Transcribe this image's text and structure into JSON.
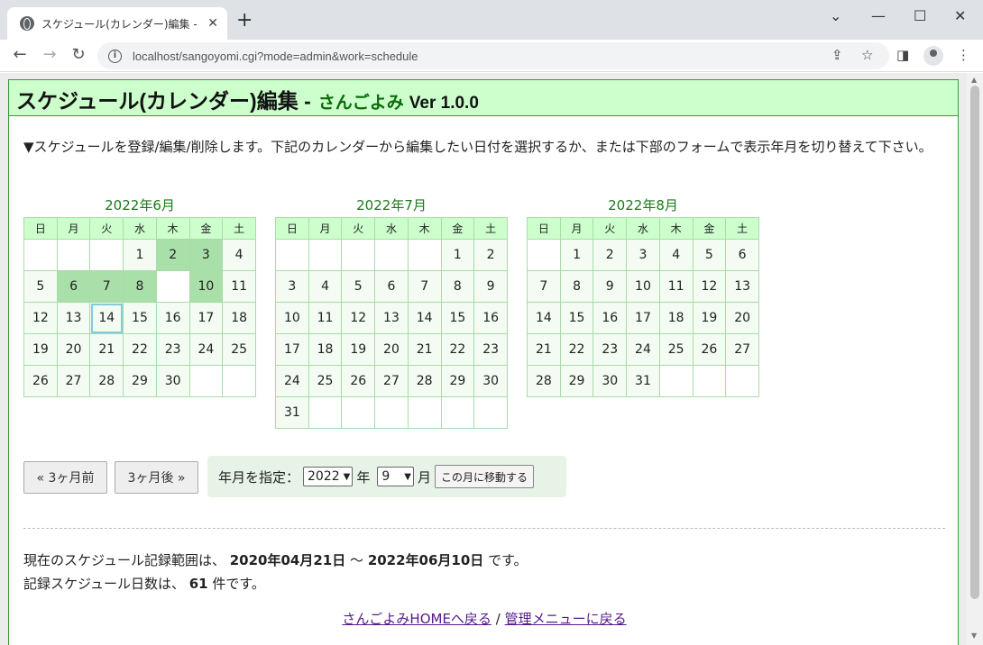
{
  "browser": {
    "tab_title": "スケジュール(カレンダー)編集 - さんごよみ",
    "url": "localhost/sangoyomi.cgi?mode=admin&work=schedule"
  },
  "header": {
    "title": "スケジュール(カレンダー)編集 -",
    "app_name": "さんごよみ",
    "version": "Ver 1.0.0"
  },
  "intro": "▼スケジュールを登録/編集/削除します。下記のカレンダーから編集したい日付を選択するか、または下部のフォームで表示年月を切り替えて下さい。",
  "weekdays": [
    "日",
    "月",
    "火",
    "水",
    "木",
    "金",
    "土"
  ],
  "calendars": [
    {
      "caption": "2022年6月",
      "weeks": [
        [
          "",
          "",
          "",
          "1",
          "2",
          "3",
          "4"
        ],
        [
          "5",
          "6",
          "7",
          "8",
          "",
          "10",
          "11"
        ],
        [
          "12",
          "13",
          "14",
          "15",
          "16",
          "17",
          "18"
        ],
        [
          "19",
          "20",
          "21",
          "22",
          "23",
          "24",
          "25"
        ],
        [
          "26",
          "27",
          "28",
          "29",
          "30",
          "",
          ""
        ]
      ],
      "scheduled": [
        "2",
        "3",
        "6",
        "7",
        "8",
        "10"
      ],
      "today": "14"
    },
    {
      "caption": "2022年7月",
      "weeks": [
        [
          "",
          "",
          "",
          "",
          "",
          "1",
          "2"
        ],
        [
          "3",
          "4",
          "5",
          "6",
          "7",
          "8",
          "9"
        ],
        [
          "10",
          "11",
          "12",
          "13",
          "14",
          "15",
          "16"
        ],
        [
          "17",
          "18",
          "19",
          "20",
          "21",
          "22",
          "23"
        ],
        [
          "24",
          "25",
          "26",
          "27",
          "28",
          "29",
          "30"
        ],
        [
          "31",
          "",
          "",
          "",
          "",
          "",
          ""
        ]
      ],
      "scheduled": [],
      "today": ""
    },
    {
      "caption": "2022年8月",
      "weeks": [
        [
          "",
          "1",
          "2",
          "3",
          "4",
          "5",
          "6"
        ],
        [
          "7",
          "8",
          "9",
          "10",
          "11",
          "12",
          "13"
        ],
        [
          "14",
          "15",
          "16",
          "17",
          "18",
          "19",
          "20"
        ],
        [
          "21",
          "22",
          "23",
          "24",
          "25",
          "26",
          "27"
        ],
        [
          "28",
          "29",
          "30",
          "31",
          "",
          "",
          ""
        ]
      ],
      "scheduled": [],
      "today": ""
    }
  ],
  "controls": {
    "prev_label": "« 3ヶ月前",
    "next_label": "3ヶ月後 »",
    "form_label": "年月を指定：",
    "year_value": "2022",
    "year_suffix": "年",
    "month_value": "9",
    "month_suffix": "月",
    "move_label": "この月に移動する"
  },
  "info": {
    "range_prefix": "現在のスケジュール記録範囲は、",
    "range_start": "2020年04月21日",
    "range_sep": "～",
    "range_end": "2022年06月10日",
    "range_suffix": "です。",
    "count_prefix": "記録スケジュール日数は、",
    "count": "61",
    "count_suffix": "件です。"
  },
  "links": {
    "home": "さんごよみHOMEへ戻る",
    "sep": "/",
    "menu": "管理メニューに戻る"
  }
}
